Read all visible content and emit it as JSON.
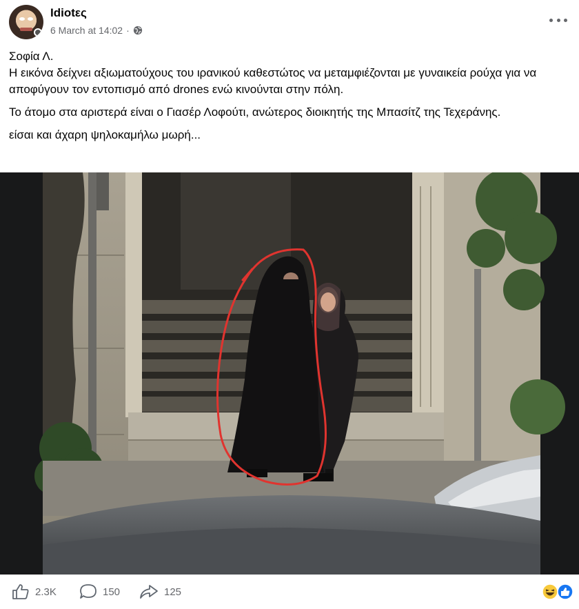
{
  "post": {
    "author": "Idiotες",
    "timestamp": "6 March at 14:02",
    "separator": "·",
    "audience_icon": "globe-icon",
    "text_line1": "Σοφία Λ.",
    "text_line2": "Η εικόνα δείχνει αξιωματούχους του ιρανικού καθεστώτος να μεταμφιέζονται με γυναικεία ρούχα για να αποφύγουν τον εντοπισμό από drones ενώ κινούνται στην πόλη.",
    "text_para2": "Το άτομο στα αριστερά είναι ο Γιασέρ Λοφούτι, ανώτερος διοικητής της Μπασίτζ της Τεχεράνης.",
    "text_para3": "είσαι και άχαρη ψηλοκαμήλω μωρή..."
  },
  "footer": {
    "likes": "2.3K",
    "comments": "150",
    "shares": "125",
    "like_icon": "thumbs-up-icon",
    "comment_icon": "comment-icon",
    "share_icon": "share-arrow-icon",
    "reaction_icons": [
      "haha-emoji-icon",
      "like-reaction-icon"
    ]
  },
  "colors": {
    "text": "#050505",
    "secondary": "#65676b",
    "like_blue": "#1877f2",
    "annotation_red": "#e0342f"
  }
}
